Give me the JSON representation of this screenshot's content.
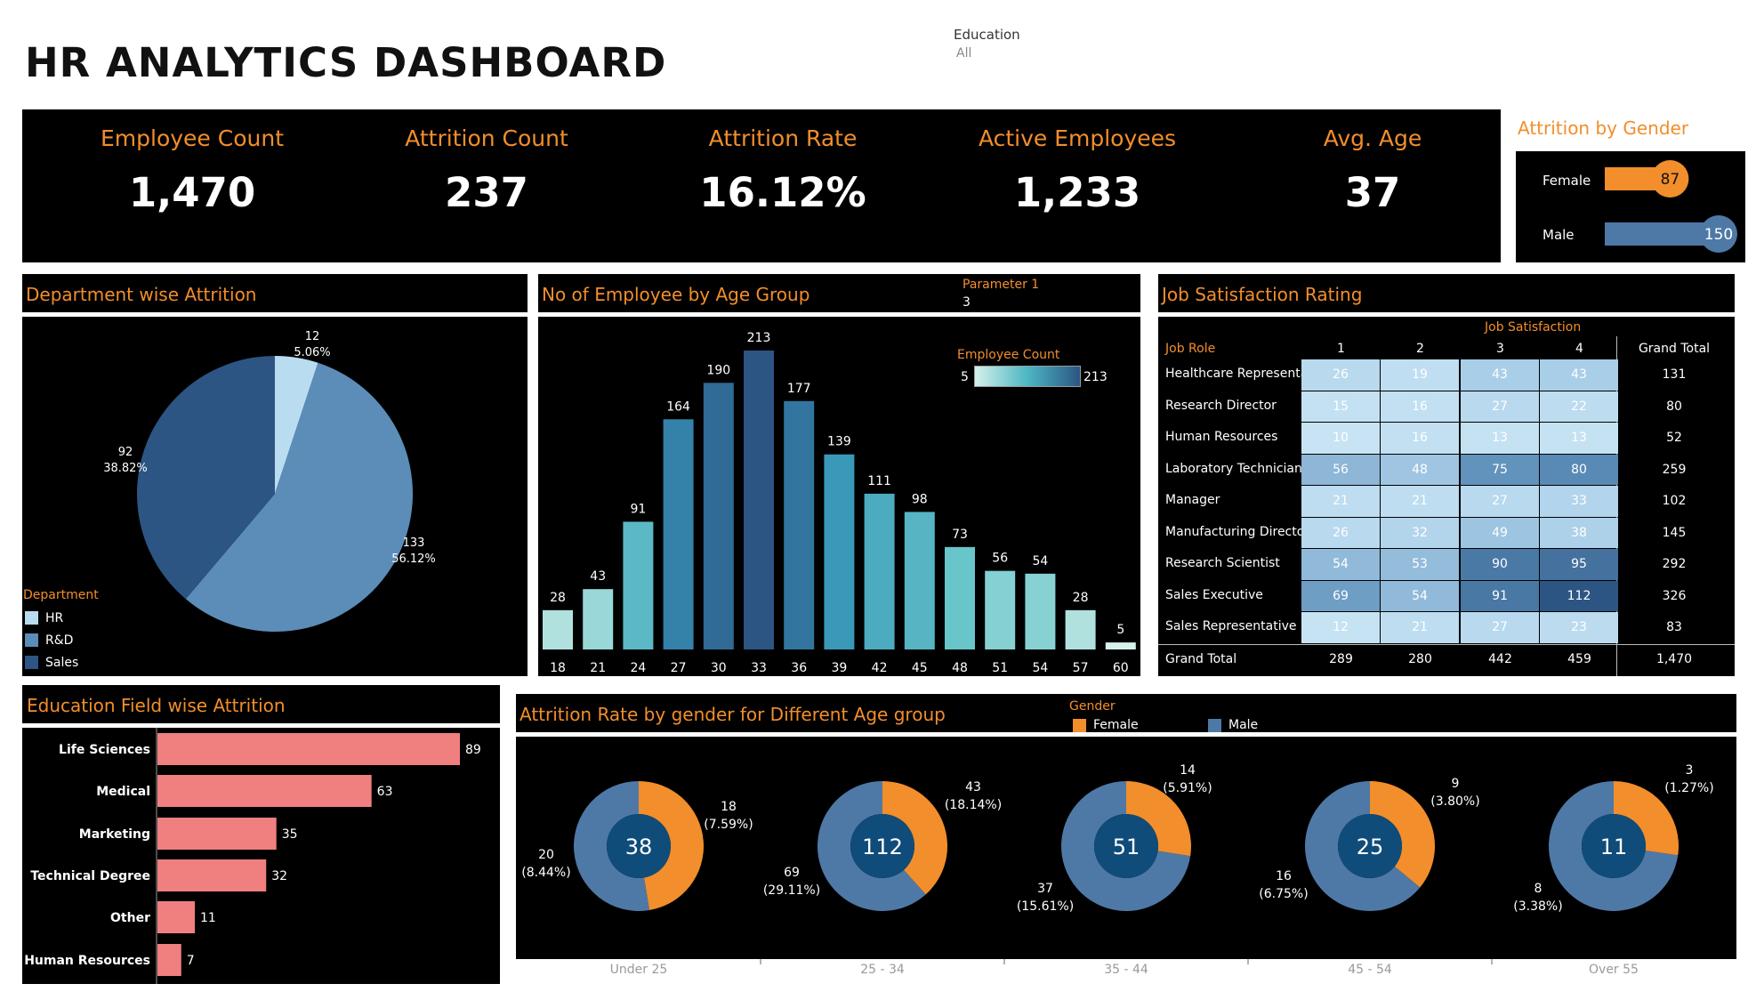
{
  "page": {
    "title": "HR ANALYTICS DASHBOARD",
    "filter_label": "Education",
    "filter_value": "All"
  },
  "kpis": [
    {
      "label": "Employee Count",
      "value": "1,470"
    },
    {
      "label": "Attrition Count",
      "value": "237"
    },
    {
      "label": "Attrition Rate",
      "value": "16.12%"
    },
    {
      "label": "Active Employees",
      "value": "1,233"
    },
    {
      "label": "Avg. Age",
      "value": "37"
    }
  ],
  "gender_panel": {
    "title": "Attrition by Gender",
    "rows": [
      {
        "label": "Female",
        "value": 87,
        "color": "#f28e2b"
      },
      {
        "label": "Male",
        "value": 150,
        "color": "#4e79a7"
      }
    ]
  },
  "dept_panel": {
    "title": "Department wise Attrition",
    "legend_title": "Department",
    "legend": [
      {
        "label": "HR",
        "color": "#b9dcf0"
      },
      {
        "label": "R&D",
        "color": "#5b8db8"
      },
      {
        "label": "Sales",
        "color": "#2c5584"
      }
    ],
    "slices": [
      {
        "label": "HR",
        "value": 12,
        "pct": "5.06%"
      },
      {
        "label": "R&D",
        "value": 133,
        "pct": "56.12%"
      },
      {
        "label": "Sales",
        "value": 92,
        "pct": "38.82%"
      }
    ]
  },
  "age_panel": {
    "title": "No of Employee by Age Group",
    "param_label": "Parameter 1",
    "param_value": "3",
    "legend_title": "Employee Count",
    "legend_min": "5",
    "legend_max": "213"
  },
  "chart_data": [
    {
      "type": "pie",
      "title": "Department wise Attrition",
      "categories": [
        "HR",
        "R&D",
        "Sales"
      ],
      "values": [
        12,
        133,
        92
      ],
      "labels": [
        "5.06%",
        "56.12%",
        "38.82%"
      ]
    },
    {
      "type": "bar",
      "title": "No of Employee by Age Group",
      "categories": [
        "18",
        "21",
        "24",
        "27",
        "30",
        "33",
        "36",
        "39",
        "42",
        "45",
        "48",
        "51",
        "54",
        "57",
        "60"
      ],
      "values": [
        28,
        43,
        91,
        164,
        190,
        213,
        177,
        139,
        111,
        98,
        73,
        56,
        54,
        28,
        5
      ]
    },
    {
      "type": "bar",
      "title": "Education Field wise Attrition",
      "orientation": "horizontal",
      "categories": [
        "Life Sciences",
        "Medical",
        "Marketing",
        "Technical Degree",
        "Other",
        "Human Resources"
      ],
      "values": [
        89,
        63,
        35,
        32,
        11,
        7
      ]
    },
    {
      "type": "pie",
      "title": "Attrition Rate by gender for Different Age group",
      "groups": [
        {
          "age": "Under 25",
          "total": "38",
          "female": 18,
          "female_label": "18",
          "female_pct": "(7.59%)",
          "male": 20,
          "male_label": "20",
          "male_pct": "(8.44%)"
        },
        {
          "age": "25 - 34",
          "total": "112",
          "female": 43,
          "female_label": "43",
          "female_pct": "(18.14%)",
          "male": 69,
          "male_label": "69",
          "male_pct": "(29.11%)"
        },
        {
          "age": "35 - 44",
          "total": "51",
          "female": 14,
          "female_label": "14",
          "female_pct": "(5.91%)",
          "male": 37,
          "male_label": "37",
          "male_pct": "(15.61%)"
        },
        {
          "age": "45 - 54",
          "total": "25",
          "female": 9,
          "female_label": "9",
          "female_pct": "(3.80%)",
          "male": 16,
          "male_label": "16",
          "male_pct": "(6.75%)"
        },
        {
          "age": "Over 55",
          "total": "11",
          "female": 3,
          "female_label": "3",
          "female_pct": "(1.27%)",
          "male": 8,
          "male_label": "8",
          "male_pct": "(3.38%)"
        }
      ],
      "legend_title": "Gender",
      "legend": [
        {
          "label": "Female",
          "color": "#f28e2b"
        },
        {
          "label": "Male",
          "color": "#4e79a7"
        }
      ]
    }
  ],
  "job_panel": {
    "title": "Job Satisfaction Rating",
    "col_group": "Job Satisfaction",
    "row_header": "Job Role",
    "columns": [
      "1",
      "2",
      "3",
      "4",
      "Grand Total"
    ],
    "rows": [
      {
        "role": "Healthcare Representative",
        "values": [
          26,
          19,
          43,
          43
        ],
        "total": "131"
      },
      {
        "role": "Research Director",
        "values": [
          15,
          16,
          27,
          22
        ],
        "total": "80"
      },
      {
        "role": "Human Resources",
        "values": [
          10,
          16,
          13,
          13
        ],
        "total": "52"
      },
      {
        "role": "Laboratory Technician",
        "values": [
          56,
          48,
          75,
          80
        ],
        "total": "259"
      },
      {
        "role": "Manager",
        "values": [
          21,
          21,
          27,
          33
        ],
        "total": "102"
      },
      {
        "role": "Manufacturing Director",
        "values": [
          26,
          32,
          49,
          38
        ],
        "total": "145"
      },
      {
        "role": "Research Scientist",
        "values": [
          54,
          53,
          90,
          95
        ],
        "total": "292"
      },
      {
        "role": "Sales Executive",
        "values": [
          69,
          54,
          91,
          112
        ],
        "total": "326"
      },
      {
        "role": "Sales Representative",
        "values": [
          12,
          21,
          27,
          23
        ],
        "total": "83"
      }
    ],
    "grand_total_label": "Grand Total",
    "grand_totals": [
      "289",
      "280",
      "442",
      "459",
      "1,470"
    ]
  },
  "edu_panel": {
    "title": "Education Field wise Attrition",
    "bar_color": "#f07f7f"
  },
  "gender_age_panel": {
    "title": "Attrition Rate by gender for Different Age group"
  }
}
